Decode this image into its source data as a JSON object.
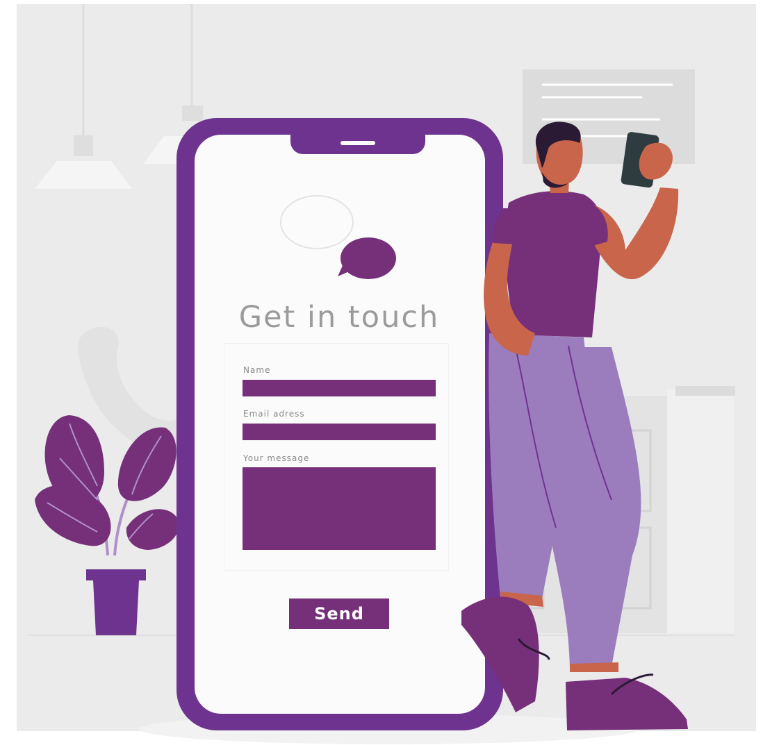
{
  "colors": {
    "background": "#ebebeb",
    "phone_frame": "#6e338f",
    "accent": "#76307a",
    "pants": "#9b7dbd",
    "skin": "#c8654a",
    "title_text": "#9b9b9b"
  },
  "contact": {
    "title": "Get in touch",
    "name_label": "Name",
    "email_label": "Email adress",
    "message_label": "Your message",
    "send_label": "Send"
  },
  "icons": [
    "chat-bubbles-icon",
    "phone-handset-icon",
    "notch-speaker-icon"
  ]
}
